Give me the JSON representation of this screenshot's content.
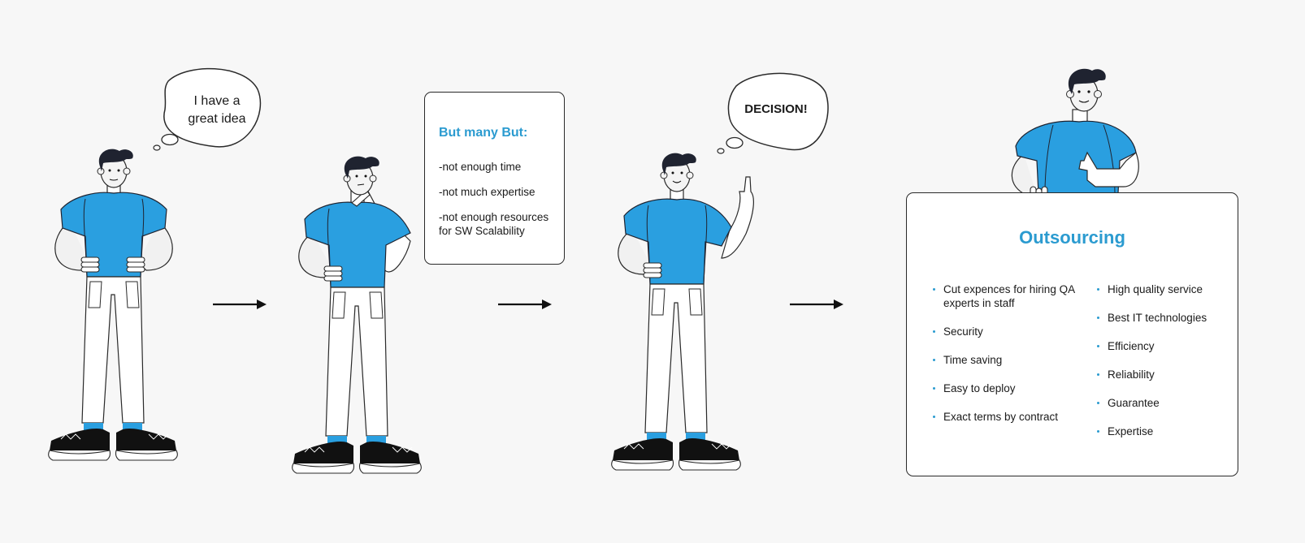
{
  "colors": {
    "accent": "#2b9bd0",
    "shirt": "#2a9fe0",
    "outline": "#1f2330",
    "background": "#f7f7f7"
  },
  "stage1": {
    "thought": [
      "I have a",
      "great idea"
    ],
    "expression": "neutral",
    "pose": "hands-on-hips"
  },
  "stage2": {
    "expression": "thinking",
    "pose": "hand-on-chin",
    "card": {
      "title": "But many But:",
      "items": [
        "-not enough time",
        "-not much expertise",
        "-not enough resources for SW Scalability"
      ]
    }
  },
  "stage3": {
    "thought": [
      "DECISION!"
    ],
    "expression": "smile",
    "pose": "finger-up"
  },
  "stage4": {
    "expression": "smile",
    "pose": "thumbs-up",
    "card": {
      "title": "Outsourcing",
      "left_items": [
        "Cut expences for hiring QA experts  in staff",
        "Security",
        "Time saving",
        "Easy to deploy",
        "Exact terms by contract"
      ],
      "right_items": [
        "High quality service",
        "Best IT technologies",
        "Efficiency",
        "Reliability",
        "Guarantee",
        "Expertise"
      ]
    }
  },
  "arrows": [
    {
      "from": "stage1",
      "to": "stage2",
      "icon": "arrow-right-icon"
    },
    {
      "from": "stage2",
      "to": "stage3",
      "icon": "arrow-right-icon"
    },
    {
      "from": "stage3",
      "to": "stage4",
      "icon": "arrow-right-icon"
    }
  ]
}
